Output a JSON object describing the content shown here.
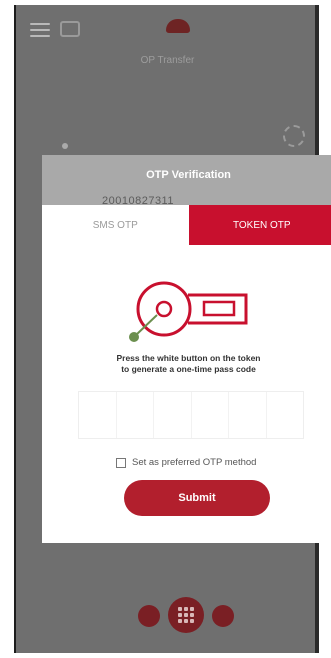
{
  "background_app": {
    "title": "OP Transfer"
  },
  "modal": {
    "header": "OTP Verification",
    "account_number": "20010827311",
    "tabs": [
      {
        "label": "SMS OTP",
        "active": false
      },
      {
        "label": "TOKEN OTP",
        "active": true
      }
    ],
    "instruction_line1": "Press the white button on the token",
    "instruction_line2": "to generate a one-time pass code",
    "otp_value": "",
    "preferred_label": "Set as preferred OTP method",
    "preferred_checked": false,
    "submit_label": "Submit"
  },
  "icons": {
    "menu": "menu-icon",
    "chat": "chat-icon",
    "logo": "bank-logo-icon",
    "token": "token-device-icon",
    "nav_left": "transfer-icon",
    "nav_center": "grid-menu-icon",
    "nav_right": "scan-icon"
  },
  "colors": {
    "accent_red": "#c8102e",
    "button_red": "#b21f2d",
    "header_gray": "#a9a9a9",
    "token_green": "#6b8f4e"
  }
}
